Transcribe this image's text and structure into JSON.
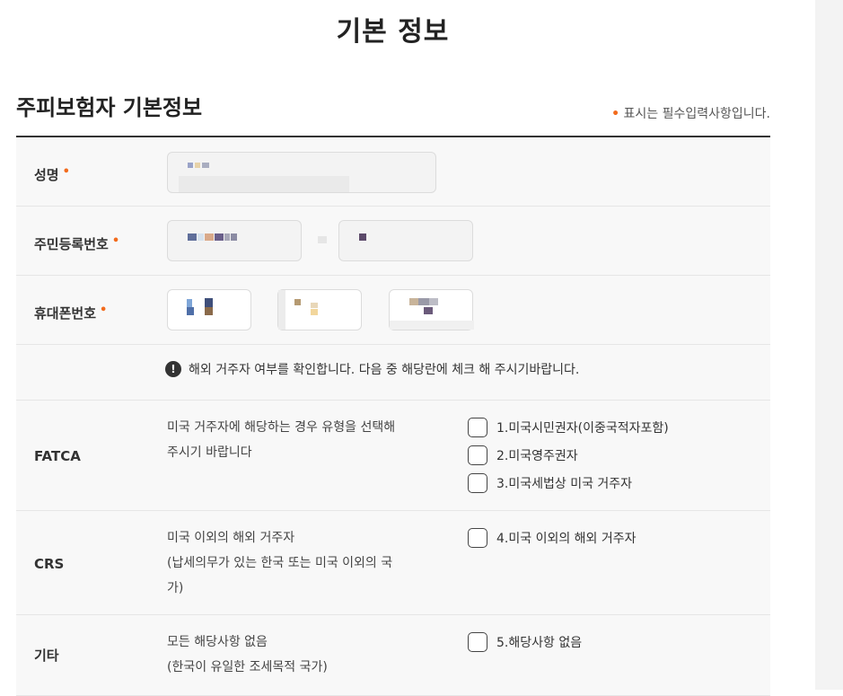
{
  "page": {
    "title": "기본 정보"
  },
  "section": {
    "title": "주피보험자 기본정보",
    "required_dot": "•",
    "required_note": "표시는 필수입력사항입니다."
  },
  "fields": {
    "name": {
      "label": "성명",
      "required": "•"
    },
    "resident_number": {
      "label": "주민등록번호",
      "required": "•"
    },
    "phone": {
      "label": "휴대폰번호",
      "required": "•"
    }
  },
  "notice": {
    "icon": "exclamation-icon",
    "text": "해외 거주자 여부를 확인합니다. 다음 중 해당란에 체크 해 주시기바랍니다."
  },
  "residency": {
    "fatca": {
      "label": "FATCA",
      "desc": [
        "미국 거주자에 해당하는 경우 유형을 선택해",
        "주시기 바랍니다"
      ],
      "options": [
        "1.미국시민권자(이중국적자포함)",
        "2.미국영주권자",
        "3.미국세법상 미국 거주자"
      ]
    },
    "crs": {
      "label": "CRS",
      "desc": [
        "미국 이외의 해외 거주자",
        "(납세의무가 있는 한국 또는 미국 이외의 국",
        "가)"
      ],
      "options": [
        "4.미국 이외의 해외 거주자"
      ]
    },
    "other": {
      "label": "기타",
      "desc": [
        "모든 해당사항 없음",
        "(한국이 유일한 조세목적 국가)"
      ],
      "options": [
        "5.해당사항 없음"
      ]
    }
  },
  "colors": {
    "accent": "#f26b1d",
    "rule": "#333333",
    "row_bg": "#f8f8f8"
  }
}
